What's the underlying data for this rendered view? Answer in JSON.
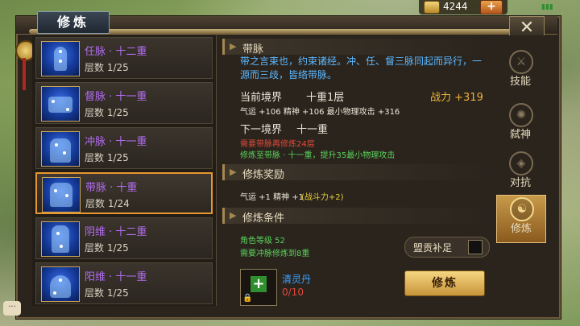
{
  "header": {
    "title": "修炼",
    "gold_amount": "4244",
    "add_label": "+"
  },
  "meridians": [
    {
      "name": "任脉 · 十二重",
      "level": "层数 1/25",
      "selected": false
    },
    {
      "name": "督脉 · 十一重",
      "level": "层数 1/25",
      "selected": false
    },
    {
      "name": "冲脉 · 十一重",
      "level": "层数 1/25",
      "selected": false
    },
    {
      "name": "带脉 · 十重",
      "level": "层数 1/24",
      "selected": true
    },
    {
      "name": "阴维 · 十二重",
      "level": "层数 1/25",
      "selected": false
    },
    {
      "name": "阳维 · 十一重",
      "level": "层数 1/25",
      "selected": false
    }
  ],
  "detail": {
    "section_title": "带脉",
    "description": "带之言束也，约束诸经。冲、任、督三脉同起而异行，一源而三歧，皆络带脉。",
    "current_label": "当前境界",
    "current_value": "十重1层",
    "power_label": "战力 +319",
    "current_stats": "气运 +106 精神 +106 最小物理攻击 +316",
    "next_label": "下一境界",
    "next_value": "十一重",
    "next_req": "需要带脉再修炼24层",
    "next_bonus": "修炼至带脉 · 十一重，提升35最小物理攻击",
    "reward_title": "修炼奖励",
    "reward_text": "气运 +1 精神 +1",
    "reward_power": "(战斗力+2)",
    "cond_title": "修炼条件",
    "cond_level": "角色等级  52",
    "cond_req": "需要冲脉修炼到8重",
    "supplement_label": "盟贡补足",
    "item_name": "清灵丹",
    "item_count": "0/10",
    "cultivate_button": "修炼"
  },
  "tabs": [
    {
      "label": "技能",
      "icon": "sword-icon"
    },
    {
      "label": "弑神",
      "icon": "seal-icon"
    },
    {
      "label": "对抗",
      "icon": "shield-icon"
    },
    {
      "label": "修炼",
      "icon": "meditation-icon",
      "selected": true
    }
  ]
}
